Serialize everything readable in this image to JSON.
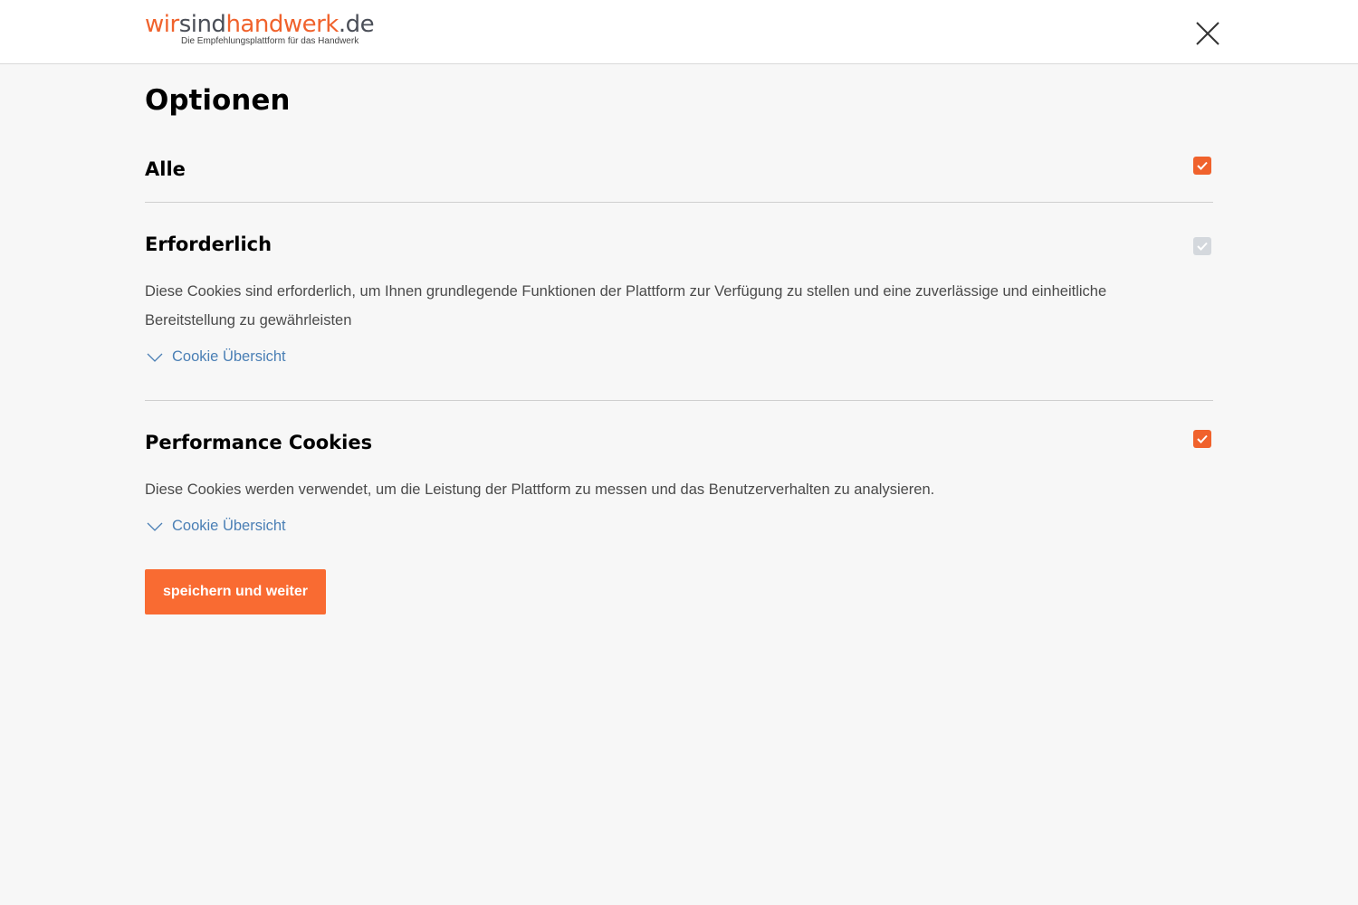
{
  "header": {
    "logo": {
      "part1": "wir",
      "part2": "sind",
      "part3": "handwerk",
      "part4": ".de",
      "tagline": "Die Empfehlungsplattform für das Handwerk"
    },
    "close_icon": "close-icon"
  },
  "main": {
    "title": "Optionen",
    "sections": [
      {
        "title": "Alle",
        "checked": true,
        "disabled": false
      },
      {
        "title": "Erforderlich",
        "checked": true,
        "disabled": true,
        "description": "Diese Cookies sind erforderlich, um Ihnen grundlegende Funktionen der Plattform zur Verfügung zu stellen und eine zuverlässige und einheitliche Bereitstellung zu gewährleisten",
        "link": "Cookie Übersicht"
      },
      {
        "title": "Performance Cookies",
        "checked": true,
        "disabled": false,
        "description": "Diese Cookies werden verwendet, um die Leistung der Plattform zu messen und das Benutzerverhalten zu analysieren.",
        "link": "Cookie Übersicht"
      }
    ],
    "save_label": "speichern und weiter"
  },
  "colors": {
    "accent": "#f0622c",
    "button": "#f96b32",
    "link": "#4a7fb5",
    "disabled_checkbox": "#d4d8dd",
    "background": "#f7f7f7"
  }
}
